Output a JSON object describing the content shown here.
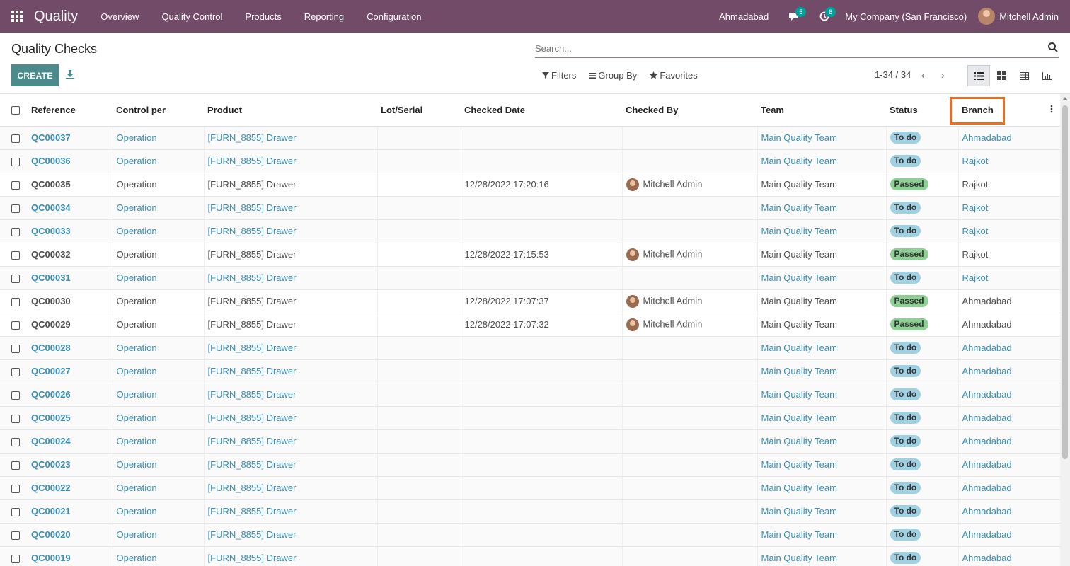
{
  "nav": {
    "app_name": "Quality",
    "menu": [
      "Overview",
      "Quality Control",
      "Products",
      "Reporting",
      "Configuration"
    ],
    "branch": "Ahmadabad",
    "messages_count": "5",
    "activities_count": "8",
    "company": "My Company (San Francisco)",
    "user": "Mitchell Admin"
  },
  "control_panel": {
    "title": "Quality Checks",
    "create_label": "CREATE",
    "search_placeholder": "Search...",
    "filters_label": "Filters",
    "group_by_label": "Group By",
    "favorites_label": "Favorites",
    "pager": "1-34 / 34"
  },
  "table": {
    "headers": {
      "reference": "Reference",
      "control_per": "Control per",
      "product": "Product",
      "lot_serial": "Lot/Serial",
      "checked_date": "Checked Date",
      "checked_by": "Checked By",
      "team": "Team",
      "status": "Status",
      "branch": "Branch"
    },
    "rows": [
      {
        "reference": "QC00037",
        "control_per": "Operation",
        "product": "[FURN_8855] Drawer",
        "lot": "",
        "checked_date": "",
        "checked_by": "",
        "team": "Main Quality Team",
        "status": "To do",
        "branch": "Ahmadabad"
      },
      {
        "reference": "QC00036",
        "control_per": "Operation",
        "product": "[FURN_8855] Drawer",
        "lot": "",
        "checked_date": "",
        "checked_by": "",
        "team": "Main Quality Team",
        "status": "To do",
        "branch": "Rajkot"
      },
      {
        "reference": "QC00035",
        "control_per": "Operation",
        "product": "[FURN_8855] Drawer",
        "lot": "",
        "checked_date": "12/28/2022 17:20:16",
        "checked_by": "Mitchell Admin",
        "team": "Main Quality Team",
        "status": "Passed",
        "branch": "Rajkot"
      },
      {
        "reference": "QC00034",
        "control_per": "Operation",
        "product": "[FURN_8855] Drawer",
        "lot": "",
        "checked_date": "",
        "checked_by": "",
        "team": "Main Quality Team",
        "status": "To do",
        "branch": "Rajkot"
      },
      {
        "reference": "QC00033",
        "control_per": "Operation",
        "product": "[FURN_8855] Drawer",
        "lot": "",
        "checked_date": "",
        "checked_by": "",
        "team": "Main Quality Team",
        "status": "To do",
        "branch": "Rajkot"
      },
      {
        "reference": "QC00032",
        "control_per": "Operation",
        "product": "[FURN_8855] Drawer",
        "lot": "",
        "checked_date": "12/28/2022 17:15:53",
        "checked_by": "Mitchell Admin",
        "team": "Main Quality Team",
        "status": "Passed",
        "branch": "Rajkot"
      },
      {
        "reference": "QC00031",
        "control_per": "Operation",
        "product": "[FURN_8855] Drawer",
        "lot": "",
        "checked_date": "",
        "checked_by": "",
        "team": "Main Quality Team",
        "status": "To do",
        "branch": "Rajkot"
      },
      {
        "reference": "QC00030",
        "control_per": "Operation",
        "product": "[FURN_8855] Drawer",
        "lot": "",
        "checked_date": "12/28/2022 17:07:37",
        "checked_by": "Mitchell Admin",
        "team": "Main Quality Team",
        "status": "Passed",
        "branch": "Ahmadabad"
      },
      {
        "reference": "QC00029",
        "control_per": "Operation",
        "product": "[FURN_8855] Drawer",
        "lot": "",
        "checked_date": "12/28/2022 17:07:32",
        "checked_by": "Mitchell Admin",
        "team": "Main Quality Team",
        "status": "Passed",
        "branch": "Ahmadabad"
      },
      {
        "reference": "QC00028",
        "control_per": "Operation",
        "product": "[FURN_8855] Drawer",
        "lot": "",
        "checked_date": "",
        "checked_by": "",
        "team": "Main Quality Team",
        "status": "To do",
        "branch": "Ahmadabad"
      },
      {
        "reference": "QC00027",
        "control_per": "Operation",
        "product": "[FURN_8855] Drawer",
        "lot": "",
        "checked_date": "",
        "checked_by": "",
        "team": "Main Quality Team",
        "status": "To do",
        "branch": "Ahmadabad"
      },
      {
        "reference": "QC00026",
        "control_per": "Operation",
        "product": "[FURN_8855] Drawer",
        "lot": "",
        "checked_date": "",
        "checked_by": "",
        "team": "Main Quality Team",
        "status": "To do",
        "branch": "Ahmadabad"
      },
      {
        "reference": "QC00025",
        "control_per": "Operation",
        "product": "[FURN_8855] Drawer",
        "lot": "",
        "checked_date": "",
        "checked_by": "",
        "team": "Main Quality Team",
        "status": "To do",
        "branch": "Ahmadabad"
      },
      {
        "reference": "QC00024",
        "control_per": "Operation",
        "product": "[FURN_8855] Drawer",
        "lot": "",
        "checked_date": "",
        "checked_by": "",
        "team": "Main Quality Team",
        "status": "To do",
        "branch": "Ahmadabad"
      },
      {
        "reference": "QC00023",
        "control_per": "Operation",
        "product": "[FURN_8855] Drawer",
        "lot": "",
        "checked_date": "",
        "checked_by": "",
        "team": "Main Quality Team",
        "status": "To do",
        "branch": "Ahmadabad"
      },
      {
        "reference": "QC00022",
        "control_per": "Operation",
        "product": "[FURN_8855] Drawer",
        "lot": "",
        "checked_date": "",
        "checked_by": "",
        "team": "Main Quality Team",
        "status": "To do",
        "branch": "Ahmadabad"
      },
      {
        "reference": "QC00021",
        "control_per": "Operation",
        "product": "[FURN_8855] Drawer",
        "lot": "",
        "checked_date": "",
        "checked_by": "",
        "team": "Main Quality Team",
        "status": "To do",
        "branch": "Ahmadabad"
      },
      {
        "reference": "QC00020",
        "control_per": "Operation",
        "product": "[FURN_8855] Drawer",
        "lot": "",
        "checked_date": "",
        "checked_by": "",
        "team": "Main Quality Team",
        "status": "To do",
        "branch": "Ahmadabad"
      },
      {
        "reference": "QC00019",
        "control_per": "Operation",
        "product": "[FURN_8855] Drawer",
        "lot": "",
        "checked_date": "",
        "checked_by": "",
        "team": "Main Quality Team",
        "status": "To do",
        "branch": "Ahmadabad"
      }
    ]
  },
  "colors": {
    "navbar": "#714b67",
    "primary_button": "#4b8b8b",
    "link": "#3a8eb6",
    "todo_badge": "#9fd1e2",
    "passed_badge": "#8ecf95",
    "highlight": "#ef6c1f"
  },
  "icons": {
    "apps": "apps-grid-icon",
    "messages": "chat-icon",
    "activities": "clock-icon",
    "download": "download-icon",
    "search": "search-icon",
    "list_view": "list-view-icon",
    "kanban_view": "kanban-view-icon",
    "pivot_view": "pivot-view-icon",
    "graph_view": "graph-view-icon"
  }
}
